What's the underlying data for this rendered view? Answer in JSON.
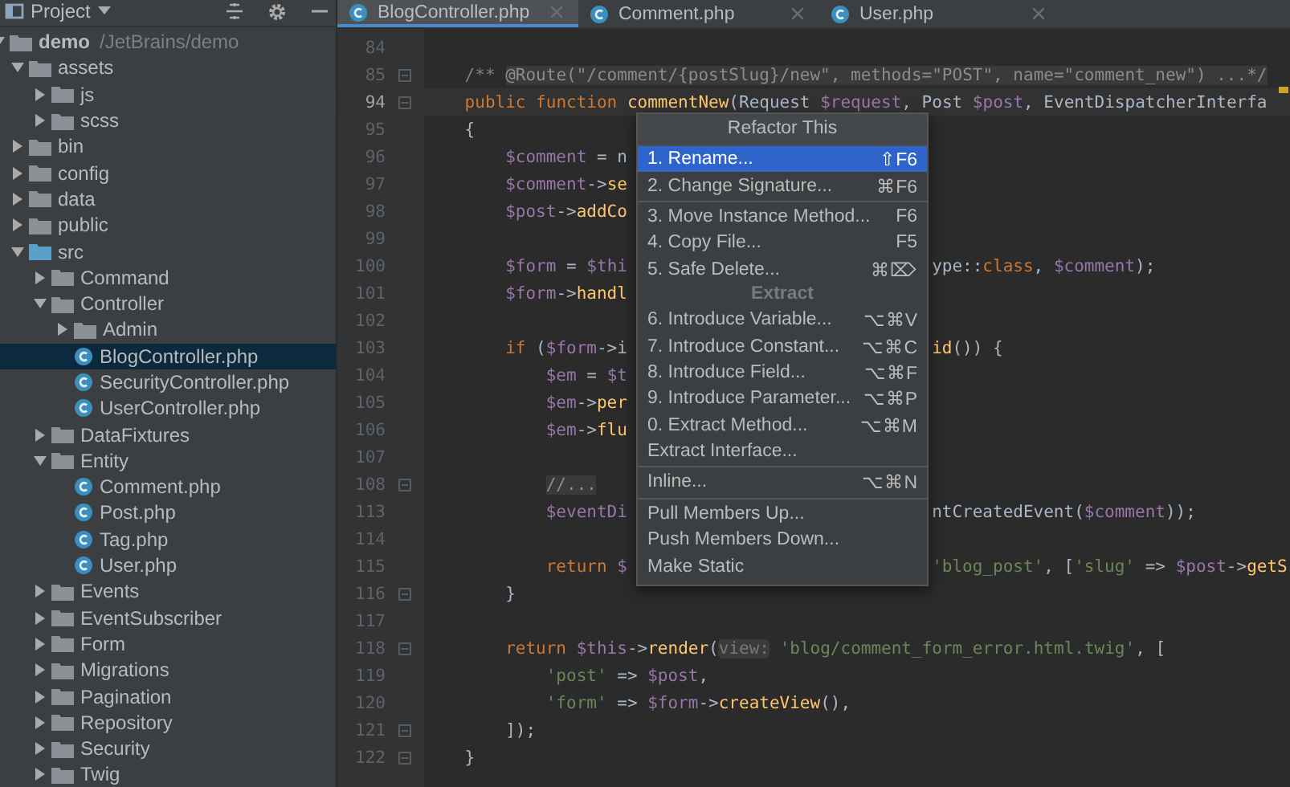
{
  "project_panel": {
    "title": "Project",
    "tree": [
      {
        "name": "demo",
        "path": "/JetBrains/demo",
        "kind": "folder",
        "expanded": true,
        "selected": false,
        "children": [
          {
            "name": "assets",
            "kind": "folder",
            "expanded": true,
            "selected": false,
            "children": [
              {
                "name": "js",
                "kind": "folder",
                "expanded": false,
                "selected": false
              },
              {
                "name": "scss",
                "kind": "folder",
                "expanded": false,
                "selected": false
              }
            ]
          },
          {
            "name": "bin",
            "kind": "folder",
            "expanded": false,
            "selected": false
          },
          {
            "name": "config",
            "kind": "folder",
            "expanded": false,
            "selected": false
          },
          {
            "name": "data",
            "kind": "folder",
            "expanded": false,
            "selected": false
          },
          {
            "name": "public",
            "kind": "folder",
            "expanded": false,
            "selected": false
          },
          {
            "name": "src",
            "kind": "source_folder",
            "expanded": true,
            "selected": false,
            "children": [
              {
                "name": "Command",
                "kind": "folder",
                "expanded": false,
                "selected": false
              },
              {
                "name": "Controller",
                "kind": "folder",
                "expanded": true,
                "selected": false,
                "children": [
                  {
                    "name": "Admin",
                    "kind": "folder",
                    "expanded": false,
                    "selected": false
                  },
                  {
                    "name": "BlogController.php",
                    "kind": "class",
                    "selected": true
                  },
                  {
                    "name": "SecurityController.php",
                    "kind": "class",
                    "selected": false
                  },
                  {
                    "name": "UserController.php",
                    "kind": "class",
                    "selected": false
                  }
                ]
              },
              {
                "name": "DataFixtures",
                "kind": "folder",
                "expanded": false,
                "selected": false
              },
              {
                "name": "Entity",
                "kind": "folder",
                "expanded": true,
                "selected": false,
                "children": [
                  {
                    "name": "Comment.php",
                    "kind": "class",
                    "selected": false
                  },
                  {
                    "name": "Post.php",
                    "kind": "class",
                    "selected": false
                  },
                  {
                    "name": "Tag.php",
                    "kind": "class",
                    "selected": false
                  },
                  {
                    "name": "User.php",
                    "kind": "class",
                    "selected": false
                  }
                ]
              },
              {
                "name": "Events",
                "kind": "folder",
                "expanded": false,
                "selected": false
              },
              {
                "name": "EventSubscriber",
                "kind": "folder",
                "expanded": false,
                "selected": false
              },
              {
                "name": "Form",
                "kind": "folder",
                "expanded": false,
                "selected": false
              },
              {
                "name": "Migrations",
                "kind": "folder",
                "expanded": false,
                "selected": false
              },
              {
                "name": "Pagination",
                "kind": "folder",
                "expanded": false,
                "selected": false
              },
              {
                "name": "Repository",
                "kind": "folder",
                "expanded": false,
                "selected": false
              },
              {
                "name": "Security",
                "kind": "folder",
                "expanded": false,
                "selected": false
              },
              {
                "name": "Twig",
                "kind": "folder",
                "expanded": false,
                "selected": false
              }
            ]
          }
        ]
      }
    ]
  },
  "tabs": [
    {
      "label": "BlogController.php",
      "selected": true
    },
    {
      "label": "Comment.php",
      "selected": false
    },
    {
      "label": "User.php",
      "selected": false
    }
  ],
  "editor": {
    "lines": [
      {
        "number": "84",
        "current": false,
        "fold": false
      },
      {
        "number": "85",
        "current": false,
        "fold": true,
        "code": [
          {
            "kind": "comment",
            "text": "    /** "
          },
          {
            "kind": "folded",
            "text": "@Route(\"/comment/{postSlug}/new\", methods=\"POST\", name=\"comment_new\") ...*/"
          }
        ]
      },
      {
        "number": "94",
        "current": true,
        "fold": true,
        "code": [
          {
            "kind": "keyword",
            "text": "    public function "
          },
          {
            "kind": "function",
            "text": "commentNew"
          },
          {
            "kind": "plain",
            "text": "(Request "
          },
          {
            "kind": "variable",
            "text": "$request"
          },
          {
            "kind": "plain",
            "text": ", Post "
          },
          {
            "kind": "variable",
            "text": "$post"
          },
          {
            "kind": "plain",
            "text": ", EventDispatcherInterfa"
          }
        ]
      },
      {
        "number": "95",
        "current": false,
        "fold": false,
        "code": [
          {
            "kind": "plain",
            "text": "    {"
          }
        ]
      },
      {
        "number": "96",
        "current": false,
        "fold": false,
        "code": [
          {
            "kind": "variable",
            "text": "        $comment"
          },
          {
            "kind": "plain",
            "text": " = n"
          }
        ]
      },
      {
        "number": "97",
        "current": false,
        "fold": false,
        "code": [
          {
            "kind": "variable",
            "text": "        $comment"
          },
          {
            "kind": "plain",
            "text": "->"
          },
          {
            "kind": "function",
            "text": "se"
          }
        ]
      },
      {
        "number": "98",
        "current": false,
        "fold": false,
        "code": [
          {
            "kind": "variable",
            "text": "        $post"
          },
          {
            "kind": "plain",
            "text": "->"
          },
          {
            "kind": "function",
            "text": "addCo"
          }
        ]
      },
      {
        "number": "99",
        "current": false,
        "fold": false
      },
      {
        "number": "100",
        "current": false,
        "fold": false,
        "code": [
          {
            "kind": "variable",
            "text": "        $form"
          },
          {
            "kind": "plain",
            "text": " = "
          },
          {
            "kind": "variable",
            "text": "$thi"
          }
        ],
        "code_after": [
          {
            "kind": "plain",
            "text": "ype::"
          },
          {
            "kind": "keyword",
            "text": "class"
          },
          {
            "kind": "plain",
            "text": ", "
          },
          {
            "kind": "variable",
            "text": "$comment"
          },
          {
            "kind": "plain",
            "text": ");"
          }
        ]
      },
      {
        "number": "101",
        "current": false,
        "fold": false,
        "code": [
          {
            "kind": "variable",
            "text": "        $form"
          },
          {
            "kind": "plain",
            "text": "->"
          },
          {
            "kind": "function",
            "text": "handl"
          }
        ]
      },
      {
        "number": "102",
        "current": false,
        "fold": false
      },
      {
        "number": "103",
        "current": false,
        "fold": false,
        "code": [
          {
            "kind": "keyword",
            "text": "        if "
          },
          {
            "kind": "plain",
            "text": "("
          },
          {
            "kind": "variable",
            "text": "$form"
          },
          {
            "kind": "plain",
            "text": "->i"
          }
        ],
        "code_after": [
          {
            "kind": "function",
            "text": "id"
          },
          {
            "kind": "plain",
            "text": "()) {"
          }
        ]
      },
      {
        "number": "104",
        "current": false,
        "fold": false,
        "code": [
          {
            "kind": "variable",
            "text": "            $em"
          },
          {
            "kind": "plain",
            "text": " = "
          },
          {
            "kind": "variable",
            "text": "$t"
          }
        ]
      },
      {
        "number": "105",
        "current": false,
        "fold": false,
        "code": [
          {
            "kind": "variable",
            "text": "            $em"
          },
          {
            "kind": "plain",
            "text": "->"
          },
          {
            "kind": "function",
            "text": "per"
          }
        ]
      },
      {
        "number": "106",
        "current": false,
        "fold": false,
        "code": [
          {
            "kind": "variable",
            "text": "            $em"
          },
          {
            "kind": "plain",
            "text": "->"
          },
          {
            "kind": "function",
            "text": "flu"
          }
        ]
      },
      {
        "number": "107",
        "current": false,
        "fold": false
      },
      {
        "number": "108",
        "current": false,
        "fold": true,
        "code": [
          {
            "kind": "folded",
            "text": "            //..."
          }
        ]
      },
      {
        "number": "113",
        "current": false,
        "fold": false,
        "code": [
          {
            "kind": "variable",
            "text": "            $eventDi"
          }
        ],
        "code_after": [
          {
            "kind": "plain",
            "text": "ntCreatedEvent("
          },
          {
            "kind": "variable",
            "text": "$comment"
          },
          {
            "kind": "plain",
            "text": "));"
          }
        ]
      },
      {
        "number": "114",
        "current": false,
        "fold": false
      },
      {
        "number": "115",
        "current": false,
        "fold": false,
        "code": [
          {
            "kind": "keyword",
            "text": "            return "
          },
          {
            "kind": "variable",
            "text": "$"
          }
        ],
        "code_after": [
          {
            "kind": "string",
            "text": "'blog_post'"
          },
          {
            "kind": "plain",
            "text": ", ["
          },
          {
            "kind": "string",
            "text": "'slug'"
          },
          {
            "kind": "plain",
            "text": " => "
          },
          {
            "kind": "variable",
            "text": "$post"
          },
          {
            "kind": "plain",
            "text": "->"
          },
          {
            "kind": "function",
            "text": "getS"
          }
        ]
      },
      {
        "number": "116",
        "current": false,
        "fold": true,
        "code": [
          {
            "kind": "plain",
            "text": "        }"
          }
        ]
      },
      {
        "number": "117",
        "current": false,
        "fold": false
      },
      {
        "number": "118",
        "current": false,
        "fold": true,
        "code": [
          {
            "kind": "keyword",
            "text": "        return "
          },
          {
            "kind": "variable",
            "text": "$this"
          },
          {
            "kind": "plain",
            "text": "->"
          },
          {
            "kind": "function",
            "text": "render"
          },
          {
            "kind": "plain",
            "text": "("
          },
          {
            "kind": "hint",
            "text": "view:"
          },
          {
            "kind": "string",
            "text": " 'blog/comment_form_error.html.twig'"
          },
          {
            "kind": "plain",
            "text": ", ["
          }
        ]
      },
      {
        "number": "119",
        "current": false,
        "fold": false,
        "code": [
          {
            "kind": "string",
            "text": "            'post'"
          },
          {
            "kind": "plain",
            "text": " => "
          },
          {
            "kind": "variable",
            "text": "$post"
          },
          {
            "kind": "plain",
            "text": ","
          }
        ]
      },
      {
        "number": "120",
        "current": false,
        "fold": false,
        "code": [
          {
            "kind": "string",
            "text": "            'form'"
          },
          {
            "kind": "plain",
            "text": " => "
          },
          {
            "kind": "variable",
            "text": "$form"
          },
          {
            "kind": "plain",
            "text": "->"
          },
          {
            "kind": "function",
            "text": "createView"
          },
          {
            "kind": "plain",
            "text": "(),"
          }
        ]
      },
      {
        "number": "121",
        "current": false,
        "fold": true,
        "code": [
          {
            "kind": "plain",
            "text": "        ]);"
          }
        ]
      },
      {
        "number": "122",
        "current": false,
        "fold": true,
        "code": [
          {
            "kind": "plain",
            "text": "    }"
          }
        ]
      }
    ]
  },
  "refactor_menu": {
    "title": "Refactor This",
    "items": [
      {
        "kind": "item",
        "label": "1. Rename...",
        "shortcut": "⇧F6",
        "selected": true
      },
      {
        "kind": "item",
        "label": "2. Change Signature...",
        "shortcut": "⌘F6",
        "selected": false
      },
      {
        "kind": "separator"
      },
      {
        "kind": "item",
        "label": "3. Move Instance Method...",
        "shortcut": "F6",
        "selected": false
      },
      {
        "kind": "item",
        "label": "4. Copy File...",
        "shortcut": "F5",
        "selected": false
      },
      {
        "kind": "item",
        "label": "5. Safe Delete...",
        "shortcut": "⌘⌦",
        "selected": false
      },
      {
        "kind": "header",
        "label": "Extract"
      },
      {
        "kind": "item",
        "label": "6. Introduce Variable...",
        "shortcut": "⌥⌘V",
        "selected": false
      },
      {
        "kind": "item",
        "label": "7. Introduce Constant...",
        "shortcut": "⌥⌘C",
        "selected": false
      },
      {
        "kind": "item",
        "label": "8. Introduce Field...",
        "shortcut": "⌥⌘F",
        "selected": false
      },
      {
        "kind": "item",
        "label": "9. Introduce Parameter...",
        "shortcut": "⌥⌘P",
        "selected": false
      },
      {
        "kind": "item",
        "label": "0. Extract Method...",
        "shortcut": "⌥⌘M",
        "selected": false
      },
      {
        "kind": "item",
        "label": "Extract Interface...",
        "selected": false
      },
      {
        "kind": "separator"
      },
      {
        "kind": "item",
        "label": "Inline...",
        "shortcut": "⌥⌘N",
        "selected": false
      },
      {
        "kind": "separator"
      },
      {
        "kind": "item",
        "label": "Pull Members Up...",
        "selected": false
      },
      {
        "kind": "item",
        "label": "Push Members Down...",
        "selected": false
      },
      {
        "kind": "item",
        "label": "Make Static",
        "selected": false
      }
    ]
  }
}
